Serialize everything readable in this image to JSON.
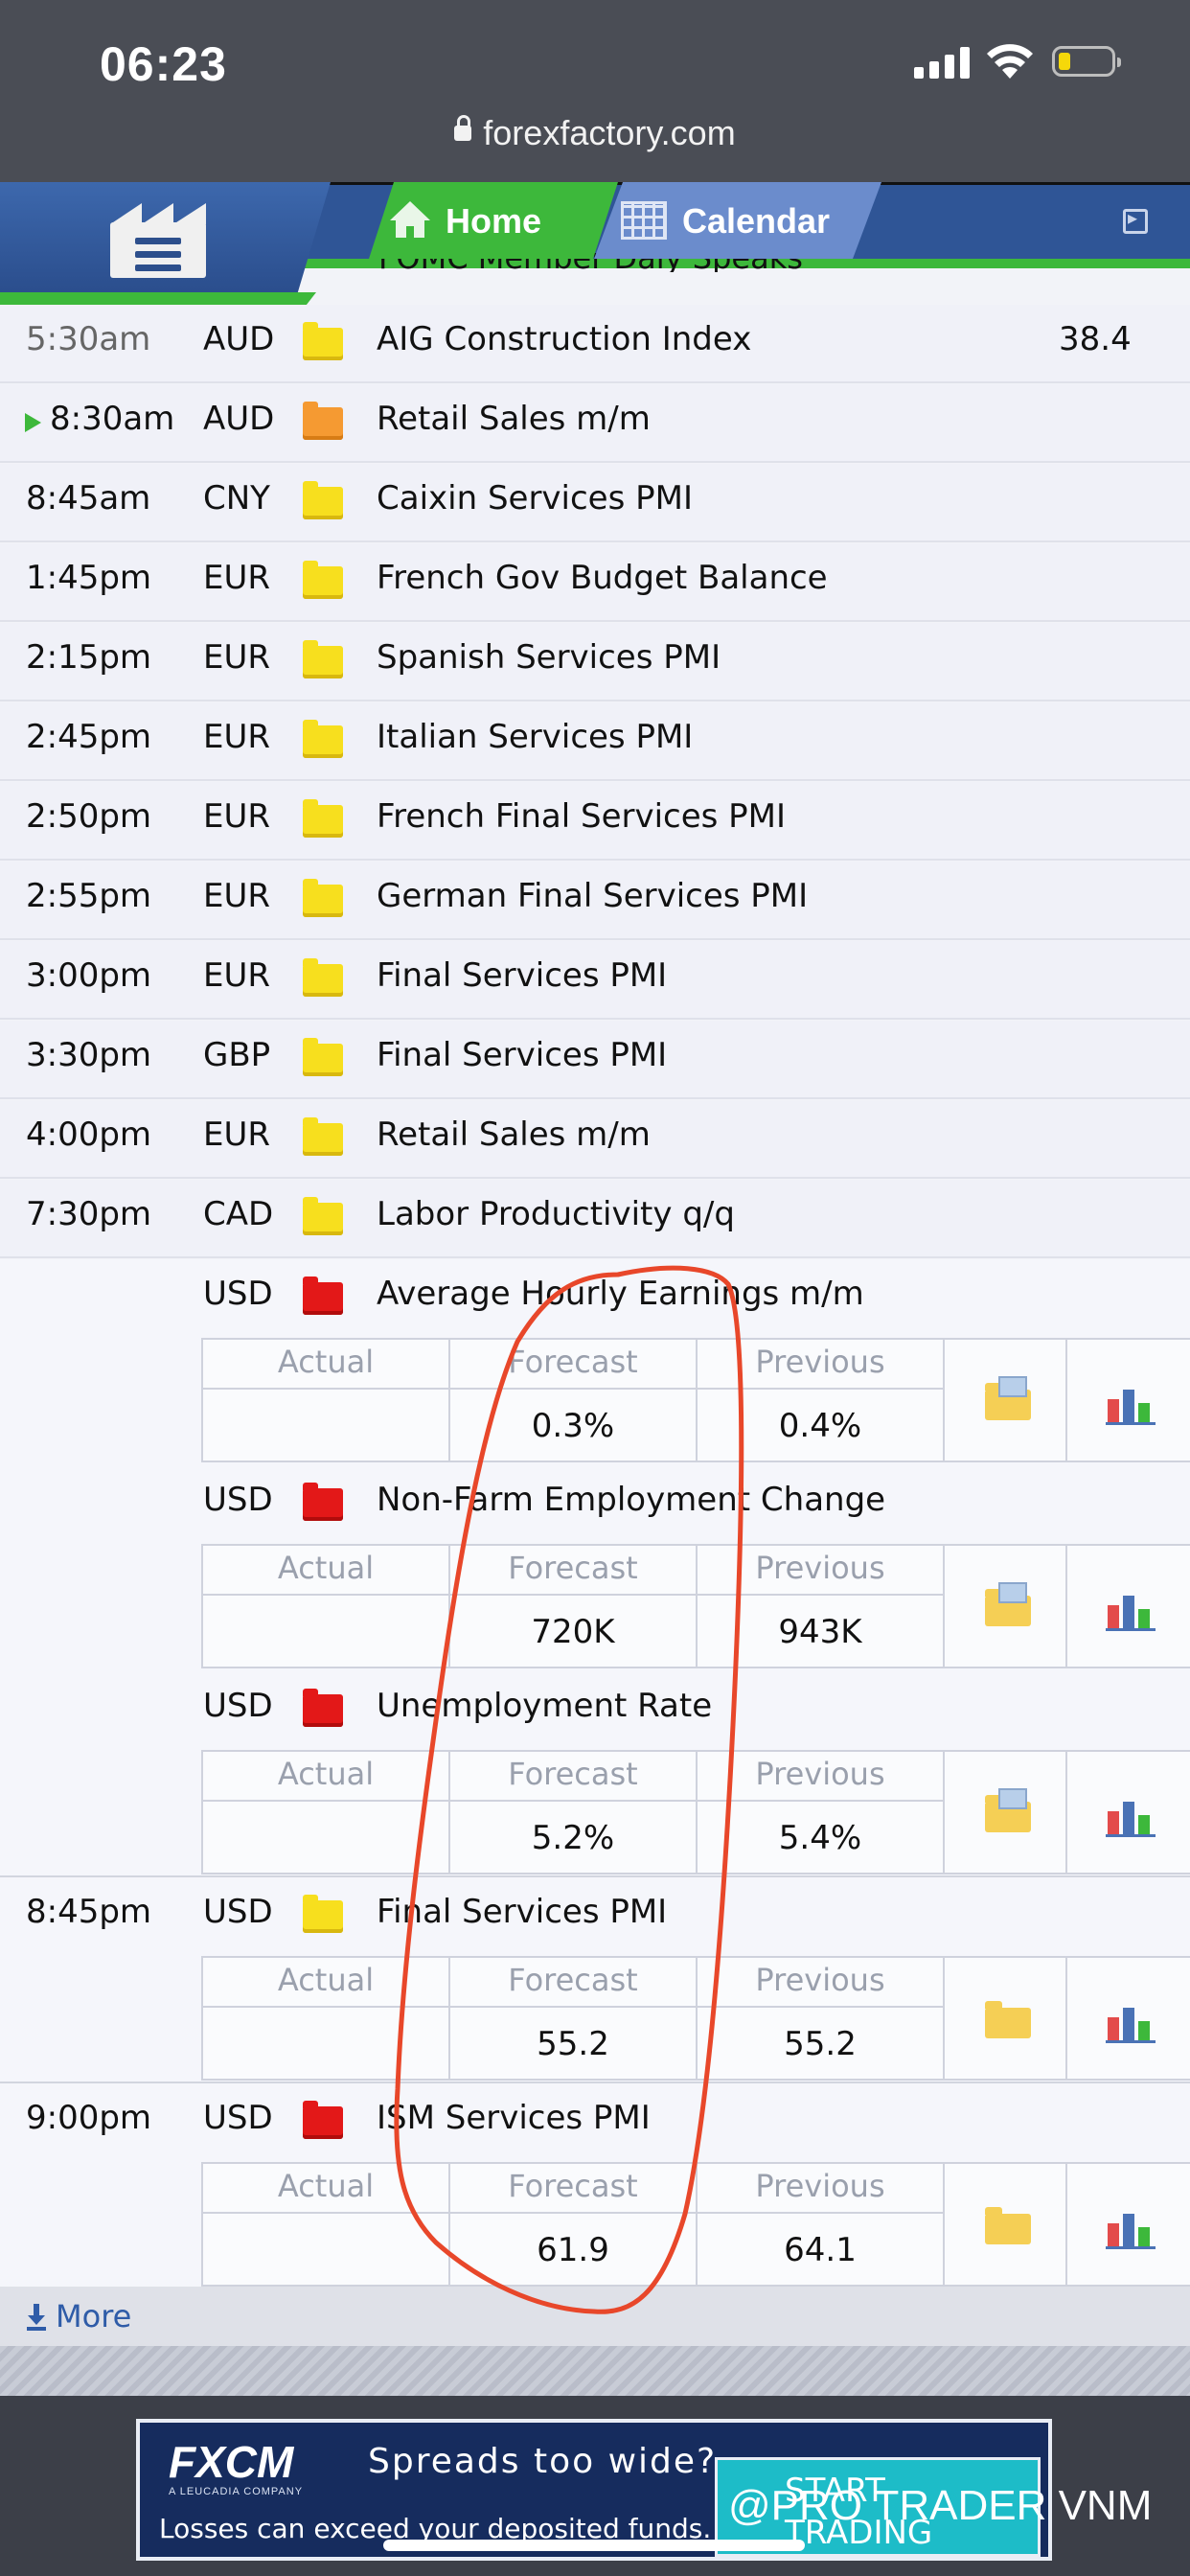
{
  "status": {
    "time": "06:23",
    "url": "forexfactory.com"
  },
  "nav": {
    "home_label": "Home",
    "calendar_label": "Calendar",
    "cut_row": "FOMC Member Daly Speaks"
  },
  "rows": [
    {
      "time": "5:30am",
      "currency": "AUD",
      "impact": "yellow",
      "event": "AIG Construction Index",
      "actual": "38.4"
    },
    {
      "time": "8:30am",
      "currency": "AUD",
      "impact": "orange",
      "event": "Retail Sales m/m",
      "actual": ""
    },
    {
      "time": "8:45am",
      "currency": "CNY",
      "impact": "yellow",
      "event": "Caixin Services PMI",
      "actual": ""
    },
    {
      "time": "1:45pm",
      "currency": "EUR",
      "impact": "yellow",
      "event": "French Gov Budget Balance",
      "actual": ""
    },
    {
      "time": "2:15pm",
      "currency": "EUR",
      "impact": "yellow",
      "event": "Spanish Services PMI",
      "actual": ""
    },
    {
      "time": "2:45pm",
      "currency": "EUR",
      "impact": "yellow",
      "event": "Italian Services PMI",
      "actual": ""
    },
    {
      "time": "2:50pm",
      "currency": "EUR",
      "impact": "yellow",
      "event": "French Final Services PMI",
      "actual": ""
    },
    {
      "time": "2:55pm",
      "currency": "EUR",
      "impact": "yellow",
      "event": "German Final Services PMI",
      "actual": ""
    },
    {
      "time": "3:00pm",
      "currency": "EUR",
      "impact": "yellow",
      "event": "Final Services PMI",
      "actual": ""
    },
    {
      "time": "3:30pm",
      "currency": "GBP",
      "impact": "yellow",
      "event": "Final Services PMI",
      "actual": ""
    },
    {
      "time": "4:00pm",
      "currency": "EUR",
      "impact": "yellow",
      "event": "Retail Sales m/m",
      "actual": ""
    },
    {
      "time": "7:30pm",
      "currency": "CAD",
      "impact": "yellow",
      "event": "Labor Productivity q/q",
      "actual": ""
    }
  ],
  "detail_headers": {
    "actual": "Actual",
    "forecast": "Forecast",
    "previous": "Previous"
  },
  "expanded": [
    {
      "time": "",
      "currency": "USD",
      "impact": "red",
      "event": "Average Hourly Earnings m/m",
      "actual": "",
      "forecast": "0.3%",
      "previous": "0.4%",
      "folder": "doc"
    },
    {
      "time": "",
      "currency": "USD",
      "impact": "red",
      "event": "Non-Farm Employment Change",
      "actual": "",
      "forecast": "720K",
      "previous": "943K",
      "folder": "doc"
    },
    {
      "time": "",
      "currency": "USD",
      "impact": "red",
      "event": "Unemployment Rate",
      "actual": "",
      "forecast": "5.2%",
      "previous": "5.4%",
      "folder": "doc"
    },
    {
      "time": "8:45pm",
      "currency": "USD",
      "impact": "yellow",
      "event": "Final Services PMI",
      "actual": "",
      "forecast": "55.2",
      "previous": "55.2",
      "folder": "plain"
    },
    {
      "time": "9:00pm",
      "currency": "USD",
      "impact": "red",
      "event": "ISM Services PMI",
      "actual": "",
      "forecast": "61.9",
      "previous": "64.1",
      "folder": "plain"
    }
  ],
  "more_label": "More",
  "ad": {
    "brand": "FXCM",
    "sub": "A LEUCADIA COMPANY",
    "headline": "Spreads too wide?",
    "disclaimer": "Losses can exceed your deposited funds.",
    "cta": "START TRADING"
  },
  "watermark": "@PRO TRADER VNM",
  "colors": {
    "nav_blue": "#2f5596",
    "nav_green": "#3db83b",
    "impact_yellow": "#f7df1e",
    "impact_orange": "#f59a32",
    "impact_red": "#e31818",
    "annotation": "#e8472a"
  }
}
